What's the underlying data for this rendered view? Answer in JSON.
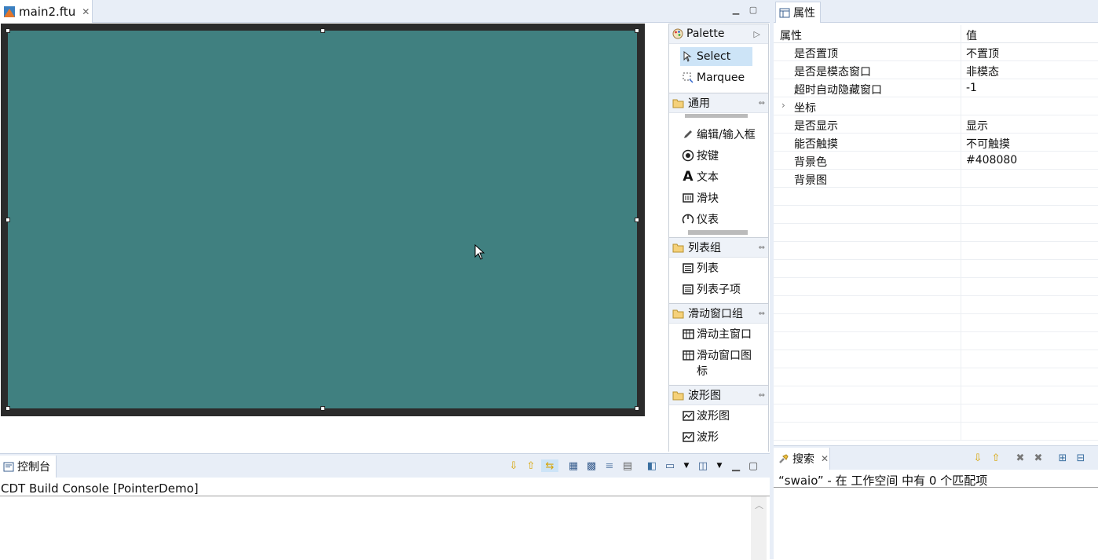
{
  "editor": {
    "tab_label": "main2.ftu",
    "screen_color": "#408080"
  },
  "palette": {
    "title": "Palette",
    "tools": [
      {
        "label": "Select",
        "icon": "arrow-pointer-icon"
      },
      {
        "label": "Marquee",
        "icon": "marquee-icon"
      }
    ],
    "groups": [
      {
        "label": "通用",
        "items": [
          {
            "label": "编辑/输入框",
            "icon": "pencil-icon"
          },
          {
            "label": "按键",
            "icon": "radio-button-icon"
          },
          {
            "label": "文本",
            "icon": "text-a-icon"
          },
          {
            "label": "滑块",
            "icon": "slider-icon"
          },
          {
            "label": "仪表",
            "icon": "gauge-icon"
          }
        ]
      },
      {
        "label": "列表组",
        "items": [
          {
            "label": "列表",
            "icon": "list-icon"
          },
          {
            "label": "列表子项",
            "icon": "list-icon"
          }
        ]
      },
      {
        "label": "滑动窗口组",
        "items": [
          {
            "label": "滑动主窗口",
            "icon": "grid-icon"
          },
          {
            "label": "滑动窗口图",
            "label2": "标",
            "icon": "grid-icon"
          }
        ]
      },
      {
        "label": "波形图",
        "items": [
          {
            "label": "波形图",
            "icon": "wave-icon"
          },
          {
            "label": "波形",
            "icon": "wave-icon"
          }
        ]
      }
    ]
  },
  "properties": {
    "tab_label": "属性",
    "col_property": "属性",
    "col_value": "值",
    "rows": [
      {
        "key": "是否置顶",
        "value": "不置顶"
      },
      {
        "key": "是否是模态窗口",
        "value": "非模态"
      },
      {
        "key": "超时自动隐藏窗口",
        "value": "-1"
      },
      {
        "key": "坐标",
        "value": "",
        "expandable": true
      },
      {
        "key": "是否显示",
        "value": "显示"
      },
      {
        "key": "能否触摸",
        "value": "不可触摸"
      },
      {
        "key": "背景色",
        "value": "#408080"
      },
      {
        "key": "背景图",
        "value": ""
      }
    ]
  },
  "console": {
    "tab_label": "控制台",
    "text": "CDT Build Console [PointerDemo]"
  },
  "search": {
    "tab_label": "搜索",
    "result": "“swaio” -  在 工作空间 中有 0 个匹配项"
  }
}
